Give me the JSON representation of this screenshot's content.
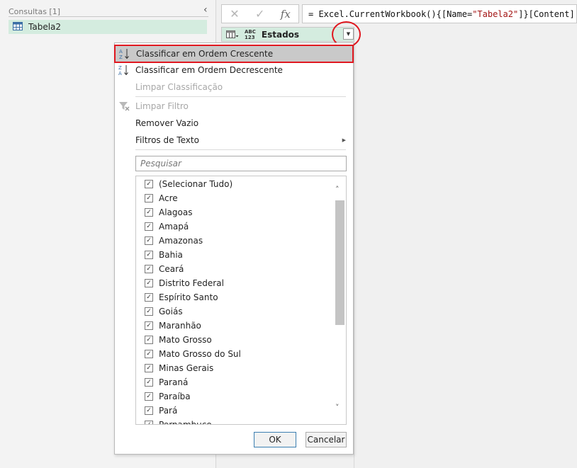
{
  "queries": {
    "header": "Consultas [1]",
    "items": [
      {
        "label": "Tabela2",
        "icon": "table-icon"
      }
    ]
  },
  "formula": {
    "cancel_icon": "cross-icon",
    "confirm_icon": "check-icon",
    "fx_label": "fx",
    "prefix": "= Excel.CurrentWorkbook(){[Name=",
    "string_value": "\"Tabela2\"",
    "suffix": "]}[Content]"
  },
  "column": {
    "type_top": "ABC",
    "type_bottom": "123",
    "name": "Estados"
  },
  "menu": {
    "sort_asc": "Classificar em Ordem Crescente",
    "sort_desc": "Classificar em Ordem Decrescente",
    "clear_sort": "Limpar Classificação",
    "clear_filter": "Limpar Filtro",
    "remove_empty": "Remover Vazio",
    "text_filters": "Filtros de Texto"
  },
  "search": {
    "placeholder": "Pesquisar"
  },
  "values": [
    "(Selecionar Tudo)",
    "Acre",
    "Alagoas",
    "Amapá",
    "Amazonas",
    "Bahia",
    "Ceará",
    "Distrito Federal",
    "Espírito Santo",
    "Goiás",
    "Maranhão",
    "Mato Grosso",
    "Mato Grosso do Sul",
    "Minas Gerais",
    "Paraná",
    "Paraíba",
    "Pará",
    "Pernambuco"
  ],
  "buttons": {
    "ok": "OK",
    "cancel": "Cancelar"
  },
  "colors": {
    "highlight_red": "#e01820",
    "selected_green": "#d4ecdf"
  }
}
